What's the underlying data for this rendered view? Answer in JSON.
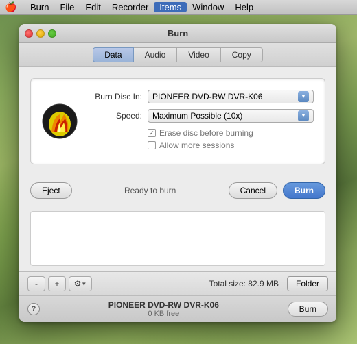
{
  "menubar": {
    "apple": "🍎",
    "items": [
      {
        "label": "Burn",
        "active": false
      },
      {
        "label": "File",
        "active": false
      },
      {
        "label": "Edit",
        "active": false
      },
      {
        "label": "Recorder",
        "active": false
      },
      {
        "label": "Items",
        "active": true
      },
      {
        "label": "Window",
        "active": false
      },
      {
        "label": "Help",
        "active": false
      }
    ]
  },
  "window": {
    "title": "Burn",
    "tabs": [
      {
        "label": "Data",
        "active": true
      },
      {
        "label": "Audio",
        "active": false
      },
      {
        "label": "Video",
        "active": false
      },
      {
        "label": "Copy",
        "active": false
      }
    ]
  },
  "dialog": {
    "burn_disc_label": "Burn Disc In:",
    "burn_disc_value": "PIONEER DVD-RW DVR-K06",
    "speed_label": "Speed:",
    "speed_value": "Maximum Possible (10x)",
    "erase_label": "Erase disc before burning",
    "sessions_label": "Allow more sessions",
    "status": "Ready to burn",
    "eject_label": "Eject",
    "cancel_label": "Cancel",
    "burn_label": "Burn"
  },
  "toolbar": {
    "minus_label": "-",
    "plus_label": "+",
    "total_size": "Total size: 82.9 MB",
    "folder_label": "Folder"
  },
  "statusbar": {
    "help_label": "?",
    "device_name": "PIONEER DVD-RW DVR-K06",
    "free_space": "0 KB free",
    "burn_label": "Burn"
  },
  "icons": {
    "fire": "fire-icon",
    "select_arrow": "dropdown-arrow",
    "gear": "⚙"
  }
}
